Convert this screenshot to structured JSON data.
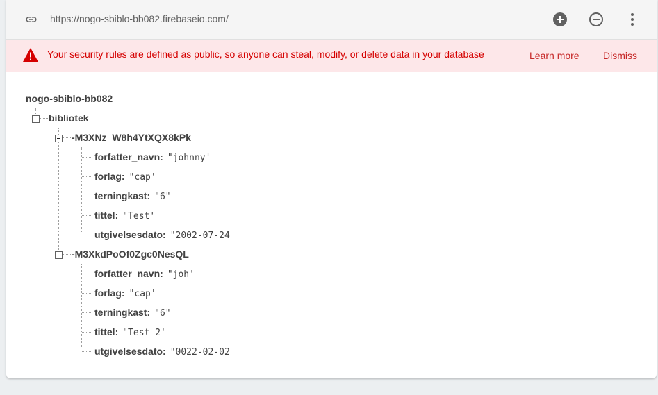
{
  "url_bar": {
    "url": "https://nogo-sbiblo-bb082.firebaseio.com/",
    "link_icon": "link-icon",
    "add_icon": "add-circle-icon",
    "remove_icon": "remove-circle-icon",
    "more_icon": "more-vert-icon"
  },
  "warning": {
    "icon": "warning-triangle-icon",
    "message": "Your security rules are defined as public, so anyone can steal, modify, or delete data in your database",
    "learn_more": "Learn more",
    "dismiss": "Dismiss",
    "color": "#d50000",
    "background": "#fde7e9"
  },
  "tree": {
    "root": "nogo-sbiblo-bb082",
    "collection": "bibliotek",
    "records": [
      {
        "key": "-M3XNz_W8h4YtXQX8kPk",
        "fields": [
          {
            "name": "forfatter_navn",
            "value": "\"johnny'"
          },
          {
            "name": "forlag",
            "value": "\"cap'"
          },
          {
            "name": "terningkast",
            "value": "\"6\""
          },
          {
            "name": "tittel",
            "value": "\"Test'"
          },
          {
            "name": "utgivelsesdato",
            "value": "\"2002-07-24"
          }
        ]
      },
      {
        "key": "-M3XkdPoOf0Zgc0NesQL",
        "fields": [
          {
            "name": "forfatter_navn",
            "value": "\"joh'"
          },
          {
            "name": "forlag",
            "value": "\"cap'"
          },
          {
            "name": "terningkast",
            "value": "\"6\""
          },
          {
            "name": "tittel",
            "value": "\"Test 2'"
          },
          {
            "name": "utgivelsesdato",
            "value": "\"0022-02-02"
          }
        ]
      }
    ]
  }
}
